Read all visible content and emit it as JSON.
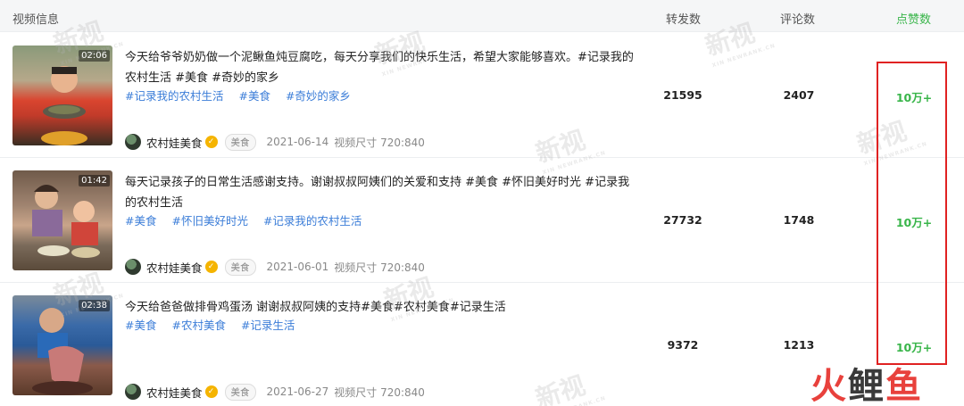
{
  "header": {
    "video_info": "视频信息",
    "shares": "转发数",
    "comments": "评论数",
    "likes": "点赞数"
  },
  "colors": {
    "like_green": "#39b54a",
    "tag_blue": "#3b7dd8",
    "highlight_red": "#e02222"
  },
  "rows": [
    {
      "duration": "02:06",
      "title": "今天给爷爷奶奶做一个泥鳅鱼炖豆腐吃，每天分享我们的快乐生活，希望大家能够喜欢。#记录我的农村生活 #美食 #奇妙的家乡",
      "tags": [
        "#记录我的农村生活",
        "#美食",
        "#奇妙的家乡"
      ],
      "author": "农村娃美食",
      "category": "美食",
      "date": "2021-06-14",
      "size": "视频尺寸 720:840",
      "shares": "21595",
      "comments": "2407",
      "likes": "10万+"
    },
    {
      "duration": "01:42",
      "title": "每天记录孩子的日常生活感谢支持。谢谢叔叔阿姨们的关爱和支持 #美食 #怀旧美好时光 #记录我的农村生活",
      "tags": [
        "#美食",
        "#怀旧美好时光",
        "#记录我的农村生活"
      ],
      "author": "农村娃美食",
      "category": "美食",
      "date": "2021-06-01",
      "size": "视频尺寸 720:840",
      "shares": "27732",
      "comments": "1748",
      "likes": "10万+"
    },
    {
      "duration": "02:38",
      "title": "今天给爸爸做排骨鸡蛋汤 谢谢叔叔阿姨的支持#美食#农村美食#记录生活",
      "tags": [
        "#美食",
        "#农村美食",
        "#记录生活"
      ],
      "author": "农村娃美食",
      "category": "美食",
      "date": "2021-06-27",
      "size": "视频尺寸 720:840",
      "shares": "9372",
      "comments": "1213",
      "likes": "10万+"
    }
  ],
  "watermark": "新视",
  "watermark_sub": "XIN NEWRANK.CN",
  "logo": {
    "part1": "火",
    "part2": "鲤",
    "part3": "鱼"
  }
}
